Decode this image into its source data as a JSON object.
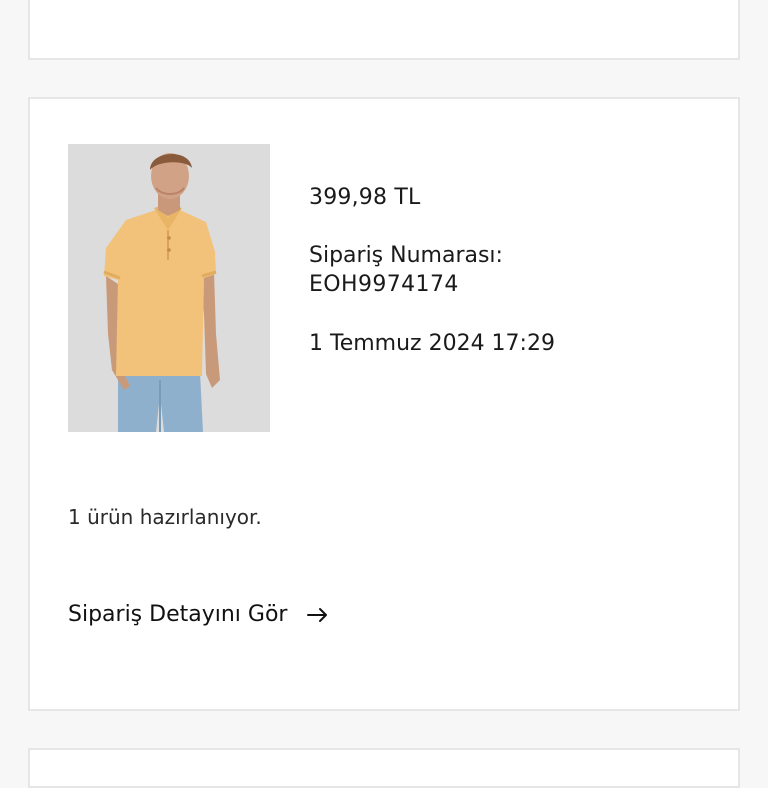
{
  "order": {
    "price": "399,98 TL",
    "order_number_label": "Sipariş Numarası:",
    "order_number": "EOH9974174",
    "date": "1 Temmuz 2024 17:29",
    "status": "1 ürün hazırlanıyor.",
    "details_link": "Sipariş Detayını Gör",
    "product_image": "man in mustard yellow polo shirt and blue jeans"
  },
  "icons": {
    "details_arrow": "arrow-right-icon"
  },
  "colors": {
    "card_border": "#e6e6e6",
    "background": "#f7f7f7",
    "product_shirt": "#f2c27a",
    "product_bg": "#dedede"
  }
}
